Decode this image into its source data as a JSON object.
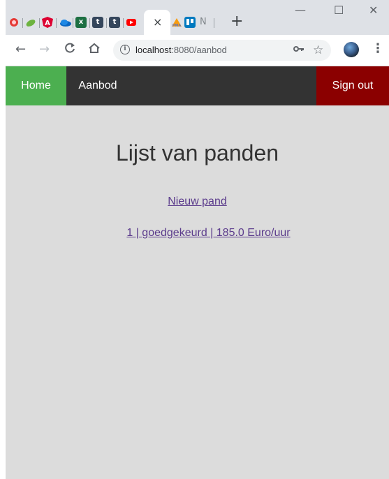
{
  "browser": {
    "tabs": [
      {
        "icon": "record-icon",
        "color": "#e53935"
      },
      {
        "icon": "leaf-icon",
        "color": "#6db33f"
      },
      {
        "icon": "angular-icon",
        "color": "#dd0031"
      },
      {
        "icon": "onedrive-icon",
        "color": "#0a66c2"
      },
      {
        "icon": "excel-icon",
        "color": "#1d6f42",
        "glyph": "x"
      },
      {
        "icon": "tumblr-icon",
        "color": "#35465c",
        "glyph": "t"
      },
      {
        "icon": "tumblr-icon",
        "color": "#35465c",
        "glyph": "t"
      },
      {
        "icon": "youtube-icon",
        "color": "#ff0000"
      },
      {
        "icon": "phpmyadmin-icon",
        "color": "#f89c0e"
      },
      {
        "icon": "trello-icon",
        "color": "#0079bf"
      }
    ],
    "active_tab_close": "×",
    "partial_tab_letter": "N",
    "new_tab_label": "+",
    "window_controls": {
      "minimize": "—",
      "maximize": "☐",
      "close": "✕"
    },
    "url_host": "localhost",
    "url_rest": ":8080/aanbod"
  },
  "nav": {
    "home": "Home",
    "aanbod": "Aanbod",
    "signout": "Sign out"
  },
  "main": {
    "title": "Lijst van panden",
    "new_link": "Nieuw pand",
    "items": [
      {
        "label": "1 | goedgekeurd | 185.0 Euro/uur"
      }
    ]
  },
  "colors": {
    "home_bg": "#4caf50",
    "nav_bg": "#333333",
    "signout_bg": "#8b0000",
    "page_bg": "#dcdcdc",
    "link": "#5b3b8c"
  }
}
